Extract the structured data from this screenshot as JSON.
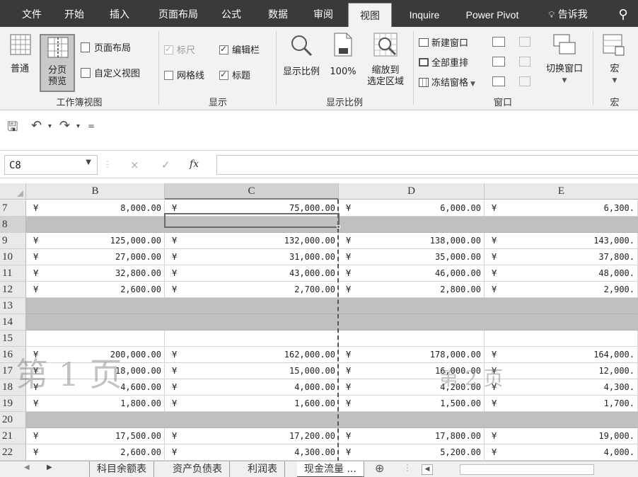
{
  "ribbon_tabs": [
    {
      "label": "文件",
      "active": false
    },
    {
      "label": "开始",
      "active": false
    },
    {
      "label": "插入",
      "active": false
    },
    {
      "label": "页面布局",
      "active": false
    },
    {
      "label": "公式",
      "active": false
    },
    {
      "label": "数据",
      "active": false
    },
    {
      "label": "审阅",
      "active": false
    },
    {
      "label": "视图",
      "active": true
    },
    {
      "label": "Inquire",
      "active": false
    },
    {
      "label": "Power Pivot",
      "active": false
    },
    {
      "label": "告诉我",
      "active": false
    }
  ],
  "tell_me_icon": "lightbulb-icon",
  "share_icon": "person-icon",
  "workbook_views": {
    "normal": "普通",
    "page_break_preview_line1": "分页",
    "page_break_preview_line2": "预览",
    "page_layout": "页面布局",
    "custom_views": "自定义视图",
    "group_label": "工作簿视图"
  },
  "show": {
    "ruler": "标尺",
    "ruler_checked": true,
    "formula_bar": "编辑栏",
    "formula_bar_checked": true,
    "gridlines": "网格线",
    "gridlines_checked": false,
    "headings": "标题",
    "headings_checked": true,
    "group_label": "显示"
  },
  "zoom": {
    "zoom": "显示比例",
    "hundred": "100%",
    "zoom_sel_line1": "缩放到",
    "zoom_sel_line2": "选定区域",
    "group_label": "显示比例"
  },
  "window": {
    "new_window": "新建窗口",
    "arrange_all": "全部重排",
    "freeze_panes": "冻结窗格",
    "switch_windows": "切换窗口",
    "group_label": "窗口"
  },
  "macros": {
    "macros": "宏",
    "group_label": "宏"
  },
  "qat": {
    "save_icon": "save-icon",
    "undo_icon": "undo-icon",
    "redo_icon": "redo-icon",
    "customize_icon": "customize-icon"
  },
  "formula_bar": {
    "name_box": "C8",
    "cancel": "×",
    "enter": "✓",
    "fx": "fx",
    "content": ""
  },
  "columns": [
    "B",
    "C",
    "D",
    "E"
  ],
  "selected_column": "C",
  "currency_symbol": "¥",
  "rows": [
    {
      "num": "7",
      "gray": false,
      "values": [
        "8,000.00",
        "75,000.00",
        "6,000.00",
        "6,300."
      ]
    },
    {
      "num": "8",
      "gray": true,
      "values": [
        "",
        "",
        "",
        ""
      ]
    },
    {
      "num": "9",
      "gray": false,
      "values": [
        "125,000.00",
        "132,000.00",
        "138,000.00",
        "143,000."
      ]
    },
    {
      "num": "10",
      "gray": false,
      "values": [
        "27,000.00",
        "31,000.00",
        "35,000.00",
        "37,800."
      ]
    },
    {
      "num": "11",
      "gray": false,
      "values": [
        "32,800.00",
        "43,000.00",
        "46,000.00",
        "48,000."
      ]
    },
    {
      "num": "12",
      "gray": false,
      "values": [
        "2,600.00",
        "2,700.00",
        "2,800.00",
        "2,900."
      ]
    },
    {
      "num": "13",
      "gray": true,
      "values": [
        "",
        "",
        "",
        ""
      ]
    },
    {
      "num": "14",
      "gray": true,
      "values": [
        "",
        "",
        "",
        ""
      ]
    },
    {
      "num": "15",
      "gray": false,
      "values": [
        "",
        "",
        "",
        ""
      ]
    },
    {
      "num": "16",
      "gray": false,
      "values": [
        "200,000.00",
        "162,000.00",
        "178,000.00",
        "164,000."
      ]
    },
    {
      "num": "17",
      "gray": false,
      "values": [
        "18,000.00",
        "15,000.00",
        "16,000.00",
        "12,000."
      ]
    },
    {
      "num": "18",
      "gray": false,
      "values": [
        "4,600.00",
        "4,000.00",
        "4,200.00",
        "4,300."
      ]
    },
    {
      "num": "19",
      "gray": false,
      "values": [
        "1,800.00",
        "1,600.00",
        "1,500.00",
        "1,700."
      ]
    },
    {
      "num": "20",
      "gray": true,
      "values": [
        "",
        "",
        "",
        ""
      ]
    },
    {
      "num": "21",
      "gray": false,
      "values": [
        "17,500.00",
        "17,200.00",
        "17,800.00",
        "19,000."
      ]
    },
    {
      "num": "22",
      "gray": false,
      "values": [
        "2,600.00",
        "4,300.00",
        "5,200.00",
        "4,000."
      ]
    }
  ],
  "selected_cell": "C8",
  "watermarks": {
    "page1": "第 1 页",
    "page2": "第 2 页"
  },
  "sheet_tabs": [
    {
      "label": "科目余额表",
      "active": false
    },
    {
      "label": "资产负债表",
      "active": false
    },
    {
      "label": "利润表",
      "active": false
    },
    {
      "label": "现金流量 ...",
      "active": true
    }
  ],
  "add_sheet": "⊕"
}
